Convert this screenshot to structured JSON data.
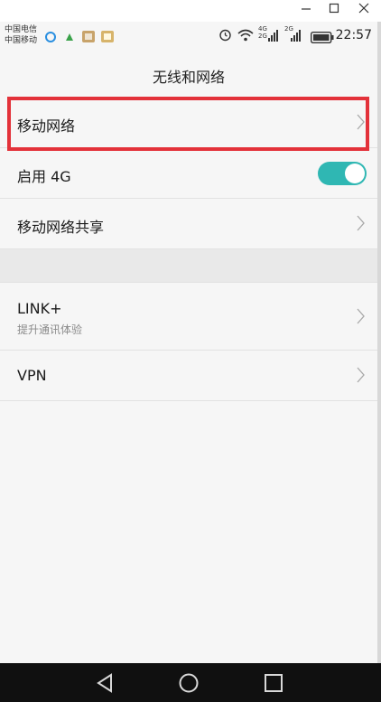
{
  "window": {
    "minimize_icon": "minimize-icon",
    "maximize_icon": "maximize-icon",
    "close_icon": "close-icon"
  },
  "status_bar": {
    "carrier_1": "中国电信",
    "carrier_2": "中国移动",
    "net_4g": "4G",
    "net_2g_a": "2G",
    "net_2g_b": "2G",
    "time": "22:57"
  },
  "page": {
    "title": "无线和网络"
  },
  "settings": {
    "mobile_network": "移动网络",
    "enable_4g": "启用 4G",
    "enable_4g_on": true,
    "tethering": "移动网络共享",
    "link_plus": "LINK+",
    "link_plus_sub": "提升通讯体验",
    "vpn": "VPN"
  },
  "colors": {
    "accent_toggle": "#2fb7b3",
    "highlight_border": "#e3323a"
  }
}
